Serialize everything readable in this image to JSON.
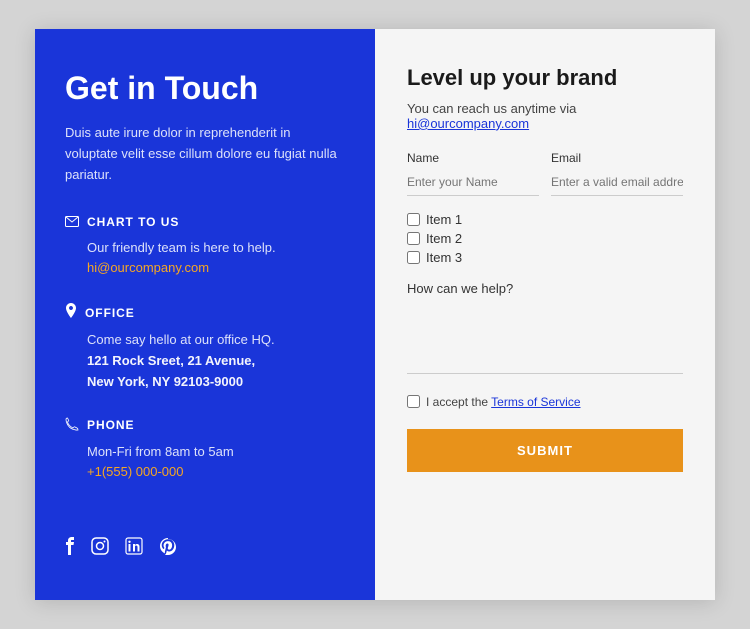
{
  "left": {
    "title": "Get in Touch",
    "description": "Duis aute irure dolor in reprehenderit in voluptate velit esse cillum dolore eu fugiat nulla pariatur.",
    "chart_section": {
      "heading": "CHART TO US",
      "body": "Our friendly team is here to help.",
      "email": "hi@ourcompany.com"
    },
    "office_section": {
      "heading": "OFFICE",
      "body": "Come say hello at our office HQ.",
      "address1": "121 Rock Sreet, 21 Avenue,",
      "address2": "New York, NY 92103-9000"
    },
    "phone_section": {
      "heading": "PHONE",
      "hours": "Mon-Fri from 8am to 5am",
      "number": "+1(555) 000-000"
    },
    "social": {
      "facebook": "f",
      "instagram": "instagram",
      "linkedin": "in",
      "pinterest": "P"
    }
  },
  "right": {
    "title": "Level up your brand",
    "reach_text": "You can reach us anytime via ",
    "reach_email": "hi@ourcompany.com",
    "name_label": "Name",
    "name_placeholder": "Enter your Name",
    "email_label": "Email",
    "email_placeholder": "Enter a valid email addres:",
    "checkboxes": [
      {
        "label": "Item 1"
      },
      {
        "label": "Item 2"
      },
      {
        "label": "Item 3"
      }
    ],
    "how_help_label": "How can we help?",
    "terms_text": "I accept the ",
    "terms_link": "Terms of Service",
    "submit_label": "SUBMIT"
  }
}
